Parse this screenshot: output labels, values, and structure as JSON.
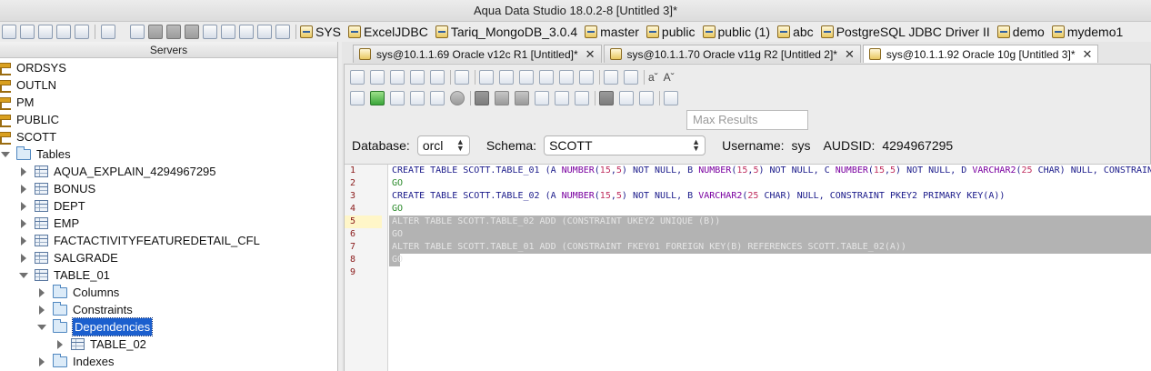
{
  "window": {
    "title": "Aqua Data Studio 18.0.2-8 [Untitled 3]*"
  },
  "toolbar": {
    "connections": [
      "SYS",
      "ExcelJDBC",
      "Tariq_MongoDB_3.0.4",
      "master",
      "public",
      "public (1)",
      "abc",
      "PostgreSQL JDBC Driver II",
      "demo",
      "mydemo1"
    ]
  },
  "servers": {
    "header": "Servers",
    "schemas": [
      "ORDSYS",
      "OUTLN",
      "PM",
      "PUBLIC",
      "SCOTT"
    ],
    "tables_folder": "Tables",
    "tables": [
      "AQUA_EXPLAIN_4294967295",
      "BONUS",
      "DEPT",
      "EMP",
      "FACTACTIVITYFEATUREDETAIL_CFL",
      "SALGRADE",
      "TABLE_01"
    ],
    "table_01_children": {
      "columns": "Columns",
      "constraints": "Constraints",
      "dependencies": "Dependencies",
      "dependency_item": "TABLE_02",
      "indexes": "Indexes"
    }
  },
  "tabs": [
    {
      "label": "sys@10.1.1.69 Oracle  v12c R1 [Untitled]*",
      "close": "✕"
    },
    {
      "label": "sys@10.1.1.70 Oracle  v11g R2 [Untitled 2]*",
      "close": "✕"
    },
    {
      "label": "sys@10.1.1.92 Oracle 10g [Untitled 3]*",
      "close": "✕"
    }
  ],
  "query": {
    "font_small": "aˇ",
    "font_big": "Aˇ",
    "max_results_placeholder": "Max Results",
    "database_label": "Database:",
    "database_value": "orcl",
    "schema_label": "Schema:",
    "schema_value": "SCOTT",
    "username_label": "Username:",
    "username_value": "sys",
    "audsid_label": "AUDSID:",
    "audsid_value": "4294967295"
  },
  "editor": {
    "line_numbers": [
      "1",
      "2",
      "3",
      "4",
      "5",
      "6",
      "7",
      "8",
      "9"
    ],
    "lines": {
      "l1": {
        "a": "CREATE TABLE SCOTT.TABLE_01 (A ",
        "t1": "NUMBER",
        "p1": "(",
        "n1": "15",
        "c1": ",",
        "n2": "5",
        "q1": ") NOT NULL, B ",
        "t2": "NUMBER",
        "p2": "(",
        "n3": "15",
        "c2": ",",
        "n4": "5",
        "q2": ") NOT NULL, C ",
        "t3": "NUMBER",
        "p3": "(",
        "n5": "15",
        "c3": ",",
        "n6": "5",
        "q3": ") NOT NULL, D ",
        "t4": "VARCHAR2",
        "p4": "(",
        "n7": "25",
        "q4": " CHAR) NULL, CONSTRAINT"
      },
      "l2": "GO",
      "l3": {
        "a": "CREATE TABLE SCOTT.TABLE_02 (A ",
        "t1": "NUMBER",
        "p1": "(",
        "n1": "15",
        "c1": ",",
        "n2": "5",
        "q1": ") NOT NULL, B ",
        "t2": "VARCHAR2",
        "p2": "(",
        "n3": "25",
        "q2": " CHAR) NULL, CONSTRAINT PKEY2 PRIMARY KEY(A))"
      },
      "l4": "GO",
      "l5": "ALTER TABLE SCOTT.TABLE_02 ADD (CONSTRAINT UKEY2 UNIQUE (B))",
      "l6": "GO",
      "l7": "ALTER TABLE SCOTT.TABLE_01 ADD (CONSTRAINT FKEY01 FOREIGN KEY(B) REFERENCES SCOTT.TABLE_02(A))",
      "l8": "GO"
    }
  }
}
